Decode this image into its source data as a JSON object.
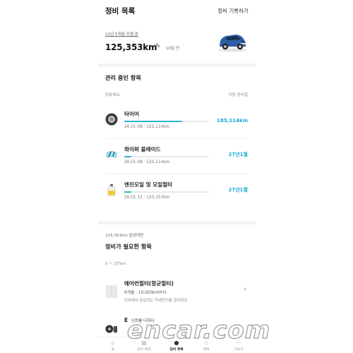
{
  "header": {
    "title": "정비 목록",
    "action_label": "정비 기록하기"
  },
  "summary": {
    "period": "13년 5개월 주행 중",
    "mileage": "125,353km",
    "updated": "10일 전"
  },
  "managed": {
    "title": "관리 중인 항목",
    "left_col": "양호해요",
    "right_col": "다음 정비일",
    "items": [
      {
        "name": "타이어",
        "meta": "26.01.08 · 125,114km",
        "next": "185,114km",
        "progress": 0.68,
        "icon": "tire-icon"
      },
      {
        "name": "와이퍼 블레이드",
        "meta": "26.01.08 · 125,114km",
        "next": "27년1월",
        "progress": 0.08,
        "icon": "wiper-icon"
      },
      {
        "name": "엔진오일 및 오일필터",
        "meta": "26.01.13 · 125,353km",
        "next": "27년1월",
        "progress": 0.08,
        "icon": "oil-bottle-icon"
      }
    ]
  },
  "needed": {
    "trigger": "125,353km 달성대면",
    "title": "정비가 필요한 항목",
    "range": "0 ~ 2만km",
    "card": {
      "name": "에어컨필터(항균필터)",
      "interval": "6개월 · 10,000km마다",
      "desc": "외부에서 유입되는 미세먼지를 걸러줘요",
      "icon": "air-filter-icon"
    },
    "partial": {
      "name": "신뢰를 더하다",
      "prefix": "E"
    }
  },
  "nav": {
    "items": [
      {
        "label": "홈",
        "icon": "home-icon",
        "active": false
      },
      {
        "label": "정비 예약",
        "icon": "calendar-icon",
        "active": false
      },
      {
        "label": "정비 목록",
        "icon": "wrench-icon",
        "active": true
      },
      {
        "label": "혜택",
        "icon": "gift-icon",
        "active": false
      },
      {
        "label": "더보기",
        "icon": "more-icon",
        "active": false
      }
    ]
  },
  "watermark": "encar.com",
  "colors": {
    "accent": "#1aa8d8",
    "bar_track": "#e6e8eb",
    "section_gap": "#f2f3f5",
    "car_body": "#2e5fa8"
  }
}
